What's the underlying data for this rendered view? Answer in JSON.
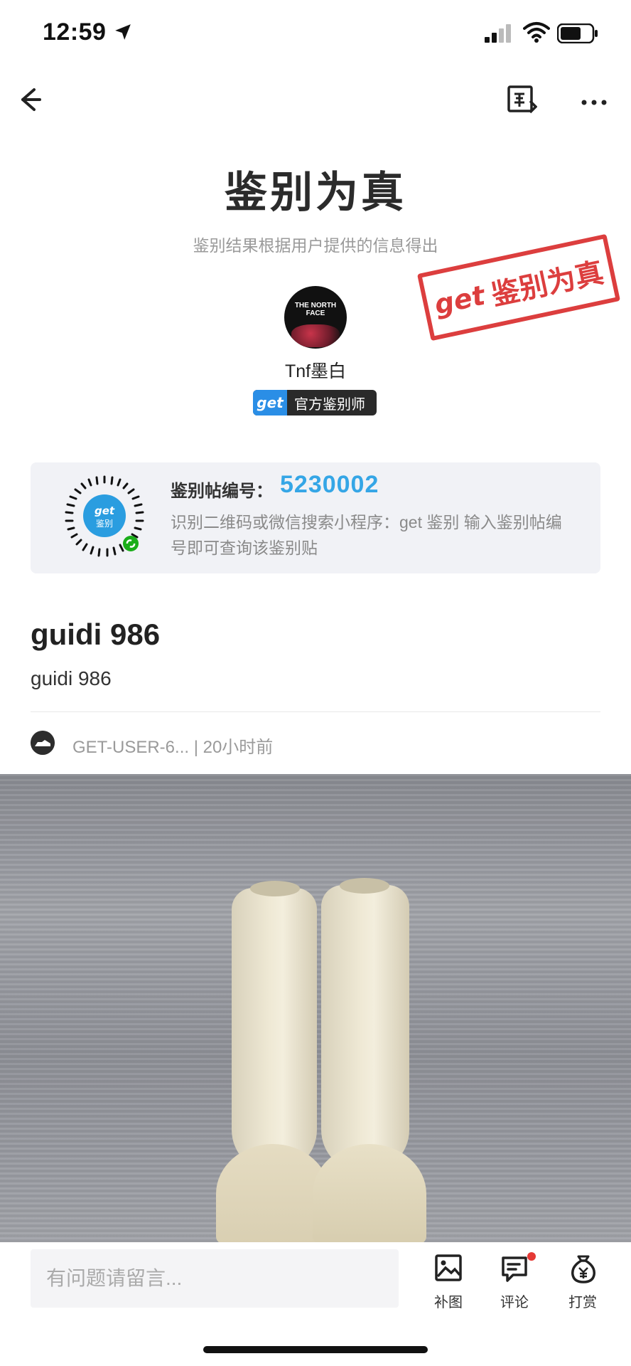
{
  "status": {
    "time": "12:59"
  },
  "icons": {
    "location": "location-arrow-icon",
    "signal": "cellular-signal-icon",
    "wifi": "wifi-icon",
    "battery": "battery-icon",
    "back": "back-arrow-icon",
    "authenticate": "authenticate-icon",
    "more": "more-dots-icon",
    "add_image": "image-icon",
    "comment": "comment-icon",
    "reward": "money-bag-icon"
  },
  "result": {
    "title": "鉴别为真",
    "subtitle": "鉴别结果根据用户提供的信息得出",
    "stamp_logo": "get",
    "stamp_text": "鉴别为真",
    "stamp_color": "#d92a2a"
  },
  "appraiser": {
    "avatar_text": "THE NORTH FACE",
    "name": "Tnf墨白",
    "badge_logo": "get",
    "badge_text": "官方鉴别师"
  },
  "post_card": {
    "label": "鉴别帖编号：",
    "number": "5230002",
    "description": "识别二维码或微信搜索小程序：get 鉴别 输入鉴别帖编号即可查询该鉴别贴",
    "qr_text": "get鉴别",
    "accent": "#35a6e6"
  },
  "post": {
    "title": "guidi 986",
    "body": "guidi 986",
    "author": "GET-USER-6...",
    "separator": "|",
    "time": "20小时前"
  },
  "bottom": {
    "comment_placeholder": "有问题请留言...",
    "actions": [
      {
        "label": "补图"
      },
      {
        "label": "评论"
      },
      {
        "label": "打赏"
      }
    ]
  }
}
